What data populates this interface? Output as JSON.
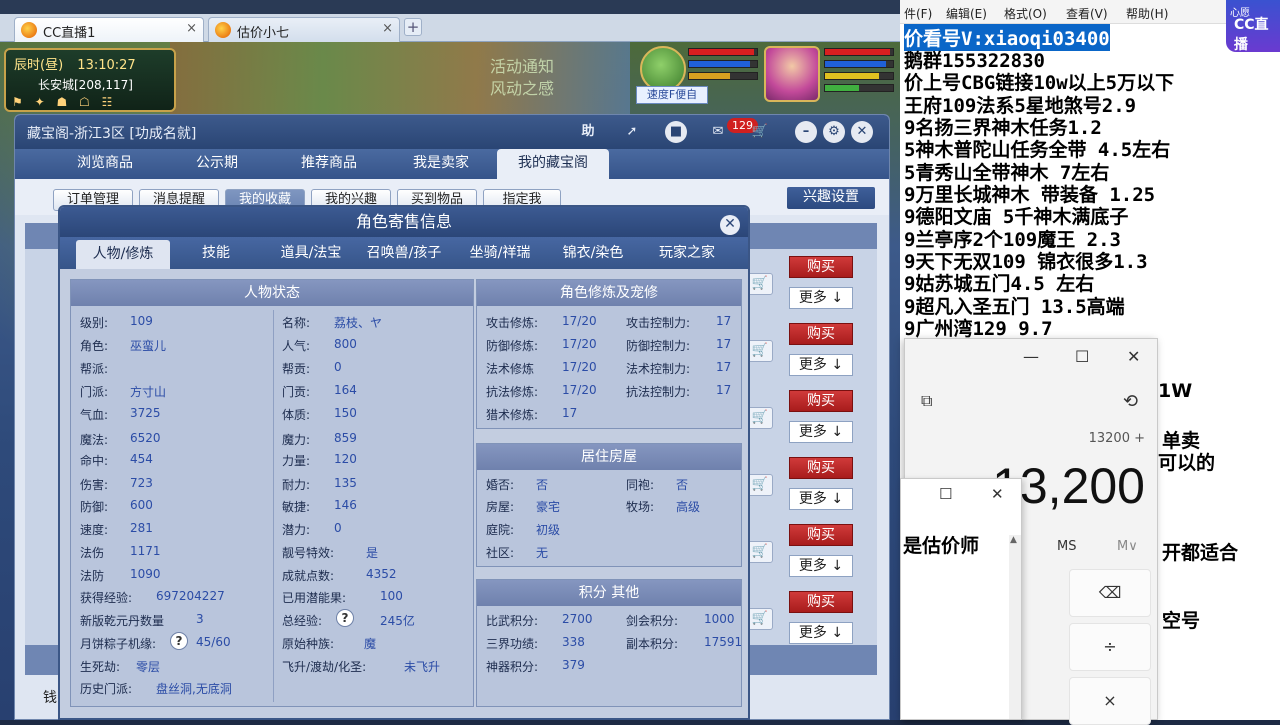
{
  "browser": {
    "tabs": [
      {
        "label": "CC直播1"
      },
      {
        "label": "估价小七"
      }
    ],
    "new_tab": "+",
    "close": "×"
  },
  "game": {
    "time_of_day": "辰时(昼)",
    "clock": "13:10:27",
    "location": "长安城[208,117]",
    "scene_text_1": "活动通知",
    "scene_text_2": "风动之感",
    "speed_button": "速度F便自",
    "hp_fraction": 0.95,
    "mp_fraction": 0.9
  },
  "shop": {
    "title": "藏宝阁-浙江3区 [功成名就]",
    "help_icon_label": "助",
    "message_count": "129",
    "nav_tabs": [
      "浏览商品",
      "公示期",
      "推荐商品",
      "我是卖家",
      "我的藏宝阁"
    ],
    "sub_tabs": [
      "订单管理",
      "消息提醒",
      "我的收藏",
      "我的兴趣",
      "买到物品",
      "指定我"
    ],
    "interest_settings": "兴趣设置",
    "buy_label": "购买",
    "more_label": "更多 ↓",
    "money_label": "钱"
  },
  "dialog": {
    "title": "角色寄售信息",
    "tabs": [
      "人物/修炼",
      "技能",
      "道具/法宝",
      "召唤兽/孩子",
      "坐骑/祥瑞",
      "锦衣/染色",
      "玩家之家"
    ],
    "status_panel": {
      "title": "人物状态",
      "left": [
        {
          "label": "级别:",
          "value": "109"
        },
        {
          "label": "角色:",
          "value": "巫蛮儿"
        },
        {
          "label": "帮派:",
          "value": ""
        },
        {
          "label": "门派:",
          "value": "方寸山"
        },
        {
          "label": "气血:",
          "value": "3725"
        },
        {
          "label": "魔法:",
          "value": "6520"
        },
        {
          "label": "命中:",
          "value": "454"
        },
        {
          "label": "伤害:",
          "value": "723"
        },
        {
          "label": "防御:",
          "value": "600"
        },
        {
          "label": "速度:",
          "value": "281"
        },
        {
          "label": "法伤",
          "value": "1171"
        },
        {
          "label": "法防",
          "value": "1090"
        },
        {
          "label": "获得经验:",
          "value": "697204227"
        },
        {
          "label": "新版乾元丹数量",
          "value": "3"
        },
        {
          "label": "月饼粽子机缘:",
          "value": "45/60"
        },
        {
          "label": "生死劫:",
          "value": "零层"
        },
        {
          "label": "历史门派:",
          "value": "盘丝洞,无底洞"
        }
      ],
      "right": [
        {
          "label": "名称:",
          "value": "荔枝、ヤ"
        },
        {
          "label": "人气:",
          "value": "800"
        },
        {
          "label": "帮贡:",
          "value": "0"
        },
        {
          "label": "门贡:",
          "value": "164"
        },
        {
          "label": "体质:",
          "value": "150"
        },
        {
          "label": "魔力:",
          "value": "859"
        },
        {
          "label": "力量:",
          "value": "120"
        },
        {
          "label": "耐力:",
          "value": "135"
        },
        {
          "label": "敏捷:",
          "value": "146"
        },
        {
          "label": "潜力:",
          "value": "0"
        },
        {
          "label": "靓号特效:",
          "value": "是"
        },
        {
          "label": "成就点数:",
          "value": "4352"
        },
        {
          "label": "已用潜能果:",
          "value": "100"
        },
        {
          "label": "总经验:",
          "value": "245亿"
        },
        {
          "label": "原始种族:",
          "value": "魔"
        },
        {
          "label": "飞升/渡劫/化圣:",
          "value": "未飞升"
        }
      ]
    },
    "cultivation_panel": {
      "title": "角色修炼及宠修",
      "rows": [
        {
          "l1": "攻击修炼:",
          "v1": "17/20",
          "l2": "攻击控制力:",
          "v2": "17"
        },
        {
          "l1": "防御修炼:",
          "v1": "17/20",
          "l2": "防御控制力:",
          "v2": "17"
        },
        {
          "l1": "法术修炼",
          "v1": "17/20",
          "l2": "法术控制力:",
          "v2": "17"
        },
        {
          "l1": "抗法修炼:",
          "v1": "17/20",
          "l2": "抗法控制力:",
          "v2": "17"
        },
        {
          "l1": "猎术修炼:",
          "v1": "17",
          "l2": "",
          "v2": ""
        }
      ]
    },
    "housing_panel": {
      "title": "居住房屋",
      "rows": [
        {
          "l1": "婚否:",
          "v1": "否",
          "l2": "同袍:",
          "v2": "否"
        },
        {
          "l1": "房屋:",
          "v1": "豪宅",
          "l2": "牧场:",
          "v2": "高级"
        },
        {
          "l1": "庭院:",
          "v1": "初级",
          "l2": "",
          "v2": ""
        },
        {
          "l1": "社区:",
          "v1": "无",
          "l2": "",
          "v2": ""
        }
      ]
    },
    "points_panel": {
      "title": "积分 其他",
      "rows": [
        {
          "l1": "比武积分:",
          "v1": "2700",
          "l2": "剑会积分:",
          "v2": "1000"
        },
        {
          "l1": "三界功绩:",
          "v1": "338",
          "l2": "副本积分:",
          "v2": "17591"
        },
        {
          "l1": "神器积分:",
          "v1": "379",
          "l2": "",
          "v2": ""
        }
      ]
    }
  },
  "notepad": {
    "menu": [
      "件(F)",
      "编辑(E)",
      "格式(O)",
      "查看(V)",
      "帮助(H)"
    ],
    "lines": [
      "价看号V:xiaoqi03400",
      "鹅群155322830",
      "价上号CBG链接10w以上5万以下",
      "王府109法系5星地煞号2.9",
      "9名扬三界神木任务1.2",
      "5神木普陀山任务全带 4.5左右",
      "5青秀山全带神木  7左右",
      "9万里长城神木 带装备  1.25",
      "9德阳文庙 5千神木满底子",
      "9兰亭序2个109魔王 2.3",
      "9天下无双109  锦衣很多1.3",
      "9姑苏城五门4.5 左右",
      "9超凡入圣五门  13.5高端",
      "9广州湾129 9.7"
    ],
    "fragments": [
      "1W",
      "单卖",
      "可以的",
      "开都适合",
      "空号"
    ],
    "cc_logo_top": "心愿",
    "cc_logo": "CC直播"
  },
  "calculator": {
    "expression": "13200 +",
    "display": "13,200",
    "ms": "MS",
    "mv": "M∨",
    "keys": [
      "⌫",
      "÷",
      "×"
    ]
  },
  "mini_window": {
    "text": "是估价师"
  }
}
